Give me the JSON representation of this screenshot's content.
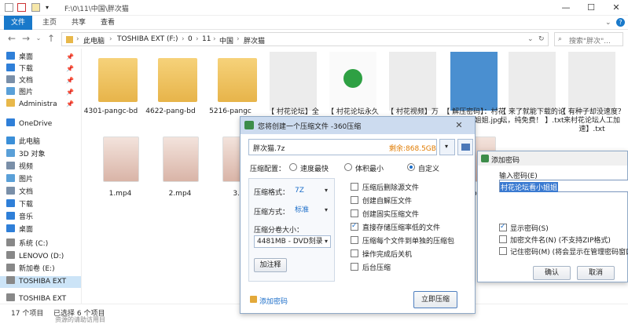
{
  "titlebar": {
    "path": "F:\\0\\11\\中国\\胖次猫",
    "min": "—",
    "max": "☐",
    "close": "✕"
  },
  "ribbon": {
    "tabs": [
      "文件",
      "主页",
      "共享",
      "查看"
    ]
  },
  "address": {
    "crumbs": [
      "此电脑",
      "TOSHIBA EXT (F:)",
      "0",
      "11",
      "中国",
      "胖次猫"
    ],
    "search_placeholder": "搜索\"胖次\"..."
  },
  "nav": {
    "items": [
      {
        "label": "桌面",
        "color": "#2f7fd8",
        "pinned": true
      },
      {
        "label": "下载",
        "color": "#2f7fd8",
        "pinned": true
      },
      {
        "label": "文档",
        "color": "#7a8fa8",
        "pinned": true
      },
      {
        "label": "图片",
        "color": "#5aa0d8",
        "pinned": true
      },
      {
        "label": "Administra",
        "color": "#e8b84a",
        "pinned": true
      },
      {
        "label": "OneDrive",
        "color": "#2f7fd8",
        "pinned": false
      },
      {
        "label": "此电脑",
        "color": "#3b8fd8",
        "pinned": false
      },
      {
        "label": "3D 对象",
        "color": "#5aa0d8",
        "pinned": false
      },
      {
        "label": "视频",
        "color": "#7a8fa8",
        "pinned": false
      },
      {
        "label": "图片",
        "color": "#5aa0d8",
        "pinned": false
      },
      {
        "label": "文档",
        "color": "#7a8fa8",
        "pinned": false
      },
      {
        "label": "下载",
        "color": "#2f7fd8",
        "pinned": false
      },
      {
        "label": "音乐",
        "color": "#2f7fd8",
        "pinned": false
      },
      {
        "label": "桌面",
        "color": "#2f7fd8",
        "pinned": false
      },
      {
        "label": "系统 (C:)",
        "color": "#888888",
        "pinned": false
      },
      {
        "label": "LENOVO (D:)",
        "color": "#888888",
        "pinned": false
      },
      {
        "label": "新加卷 (E:)",
        "color": "#888888",
        "pinned": false
      },
      {
        "label": "TOSHIBA EXT",
        "color": "#888888",
        "pinned": false
      },
      {
        "label": "TOSHIBA EXT",
        "color": "#888888",
        "pinned": false
      }
    ]
  },
  "files": {
    "row1": [
      {
        "label": "4301-pangc-bd"
      },
      {
        "label": "4622-pang-bd"
      },
      {
        "label": "5216-pangc"
      },
      {
        "label": "【 村花论坛】全"
      },
      {
        "label": "【 村花论坛永久"
      },
      {
        "label": "【 村花视频】万"
      },
      {
        "label": "【 解压密码】：村花论坛看小姐姐.jpg"
      },
      {
        "label": "【 来了就能下载的论坛，纯免费！ 】.txt"
      },
      {
        "label": "【 有种子却没速度？来村花论坛人工加速】.txt"
      }
    ],
    "row2": [
      {
        "label": "1.mp4"
      },
      {
        "label": "2.mp4"
      },
      {
        "label": "3.m"
      },
      {
        "label": "eo11"
      }
    ]
  },
  "status": {
    "count": "17 个项目",
    "selected": "已选择 6 个项目",
    "bottom_text": "资源的请助访用目"
  },
  "compress_dialog": {
    "title": "您将创建一个压缩文件 -360压缩",
    "filename": "胖次猫.7z",
    "free_space": "剩余:868.5GB",
    "config_label": "压缩配置：",
    "config_options": [
      "速度最快",
      "体积最小",
      "自定义"
    ],
    "config_selected": 2,
    "format_label": "压缩格式：",
    "format_value": "7Z",
    "method_label": "压缩方式：",
    "method_value": "标准",
    "volume_label": "压缩分卷大小：",
    "volume_value": "4481MB  - DVD刻录",
    "comment_button": "加注释",
    "options": [
      {
        "label": "压缩后删除源文件",
        "checked": false
      },
      {
        "label": "创建自解压文件",
        "checked": false
      },
      {
        "label": "创建固实压缩文件",
        "checked": false
      },
      {
        "label": "直接存储压缩率低的文件",
        "checked": true
      },
      {
        "label": "压缩每个文件到单独的压缩包",
        "checked": false
      },
      {
        "label": "操作完成后关机",
        "checked": false
      },
      {
        "label": "后台压缩",
        "checked": false
      }
    ],
    "add_password": "添加密码",
    "compress_button": "立即压缩"
  },
  "password_dialog": {
    "title": "添加密码",
    "input_label": "输入密码(E)",
    "password_value": "村花论坛看小姐姐",
    "options": [
      {
        "label": "显示密码(S)",
        "checked": true
      },
      {
        "label": "加密文件名(N) (不支持ZIP格式)",
        "checked": false
      },
      {
        "label": "记住密码(M) (将会显示在管理密码窗口中",
        "checked": false
      }
    ],
    "ok": "确认",
    "cancel": "取消"
  },
  "colors": {
    "accent": "#1979ca",
    "free_space": "#e07b00",
    "selection": "#3a7ad1"
  }
}
